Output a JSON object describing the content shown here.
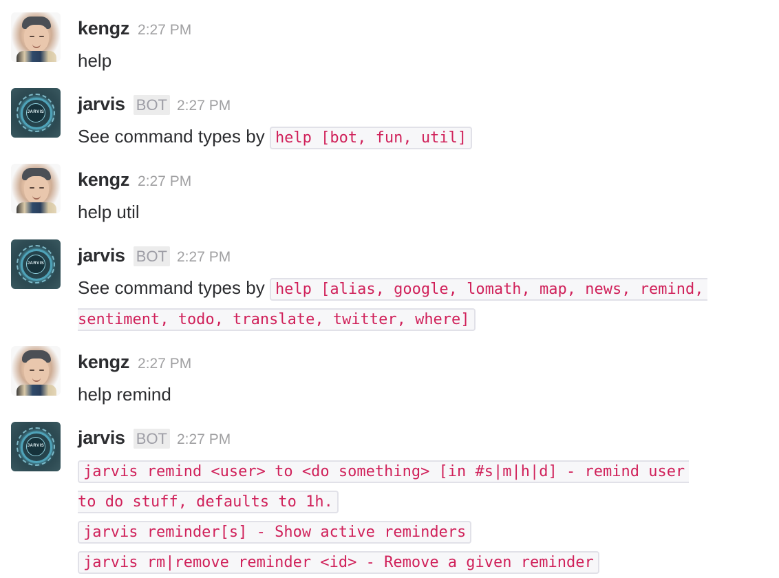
{
  "messages": [
    {
      "sender": "kengz",
      "is_bot": false,
      "avatar": "user-photo-avatar",
      "timestamp": "2:27 PM",
      "text": "help"
    },
    {
      "sender": "jarvis",
      "is_bot": true,
      "bot_badge": "BOT",
      "avatar": "jarvis-bot-avatar",
      "avatar_label": "JARVIS",
      "timestamp": "2:27 PM",
      "text": "See command types by",
      "code": "help [bot, fun, util]"
    },
    {
      "sender": "kengz",
      "is_bot": false,
      "avatar": "user-photo-avatar",
      "timestamp": "2:27 PM",
      "text": "help util"
    },
    {
      "sender": "jarvis",
      "is_bot": true,
      "bot_badge": "BOT",
      "avatar": "jarvis-bot-avatar",
      "avatar_label": "JARVIS",
      "timestamp": "2:27 PM",
      "text": "See command types by",
      "code_lines": [
        "help [alias, google, lomath, map, news, remind,",
        "sentiment, todo, translate, twitter, where]"
      ]
    },
    {
      "sender": "kengz",
      "is_bot": false,
      "avatar": "user-photo-avatar",
      "timestamp": "2:27 PM",
      "text": "help remind"
    },
    {
      "sender": "jarvis",
      "is_bot": true,
      "bot_badge": "BOT",
      "avatar": "jarvis-bot-avatar",
      "avatar_label": "JARVIS",
      "timestamp": "2:27 PM",
      "commands": [
        {
          "lines": [
            "jarvis remind <user> to <do something> [in #s|m|h|d] - remind user",
            "to do stuff, defaults to 1h."
          ]
        },
        {
          "lines": [
            "jarvis reminder[s] - Show active reminders"
          ]
        },
        {
          "lines": [
            "jarvis rm|remove reminder <id> - Remove a given reminder"
          ]
        }
      ]
    }
  ],
  "colors": {
    "code_text": "#d0215a",
    "code_background": "#f7f7f9",
    "code_border": "#e1e1e8",
    "timestamp": "#a0a0a2",
    "bot_badge_bg": "#ececec"
  }
}
